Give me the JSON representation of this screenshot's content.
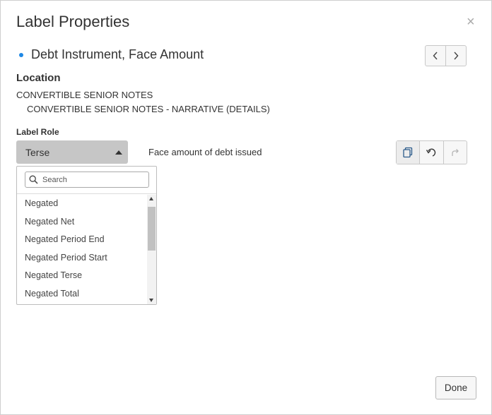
{
  "dialog": {
    "title": "Label Properties",
    "close_glyph": "×"
  },
  "concept": {
    "name": "Debt Instrument, Face Amount",
    "bullet_color": "#1e88e5"
  },
  "nav": {
    "prev_glyph": "‹",
    "next_glyph": "›"
  },
  "location": {
    "heading": "Location",
    "line1": "CONVERTIBLE SENIOR NOTES",
    "line2": "CONVERTIBLE SENIOR NOTES - NARRATIVE (DETAILS)"
  },
  "label_role": {
    "heading": "Label Role",
    "selected": "Terse",
    "label_text": "Face amount of debt issued"
  },
  "actions": {
    "icons": [
      "copy-icon",
      "undo-icon",
      "redo-icon"
    ]
  },
  "dropdown": {
    "search_placeholder": "Search",
    "items": [
      "Negated",
      "Negated Net",
      "Negated Period End",
      "Negated Period Start",
      "Negated Terse",
      "Negated Total"
    ]
  },
  "footer": {
    "done_label": "Done"
  }
}
